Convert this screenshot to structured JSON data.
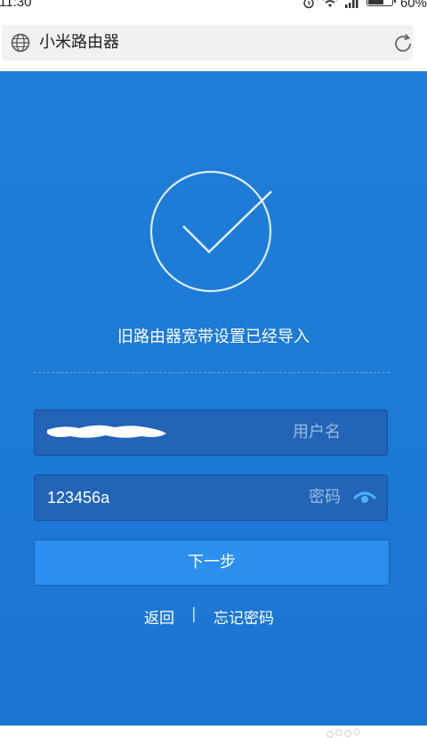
{
  "status_bar": {
    "time": "11:30",
    "battery": "60%",
    "icons": [
      "alarm-icon",
      "wifi-icon",
      "signal-icon",
      "battery-icon"
    ]
  },
  "browser": {
    "title": "小米路由器",
    "icons": [
      "globe-icon",
      "refresh-icon"
    ]
  },
  "setup": {
    "success_message": "旧路由器宽带设置已经导入",
    "username": {
      "label": "用户名",
      "value_redacted": true
    },
    "password": {
      "label": "密码",
      "value": "123456a"
    },
    "next_button": "下一步",
    "back_link": "返回",
    "separator": "|",
    "forgot_link": "忘记密码"
  },
  "colors": {
    "background_blue": "#1f7ed7",
    "field_bg": "#2164b8",
    "button_bg": "#2c8ff0",
    "eye_icon": "#4fb0ff"
  }
}
